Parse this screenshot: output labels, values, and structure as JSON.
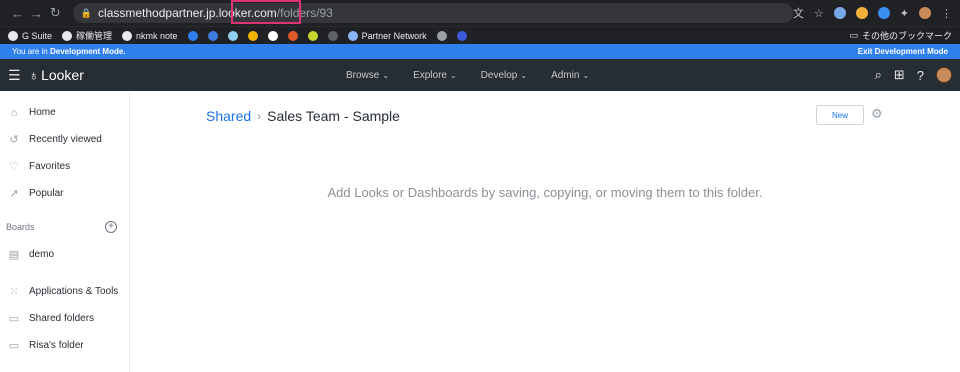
{
  "browser": {
    "url_host": "classmethodpartner.jp.looker.com",
    "url_path": "/folders/93"
  },
  "bookmarks": {
    "items": [
      "G Suite",
      "稼働管理",
      "nkmk note",
      "Partner Network"
    ],
    "other": "その他のブックマーク"
  },
  "dev_bar": {
    "prefix": "You are in ",
    "mode": "Development Mode.",
    "exit": "Exit Development Mode"
  },
  "header": {
    "logo": "Looker",
    "nav": [
      "Browse",
      "Explore",
      "Develop",
      "Admin"
    ]
  },
  "sidebar": {
    "items": [
      {
        "label": "Home",
        "icon": "home-icon"
      },
      {
        "label": "Recently viewed",
        "icon": "history-icon"
      },
      {
        "label": "Favorites",
        "icon": "heart-icon"
      },
      {
        "label": "Popular",
        "icon": "trending-icon"
      }
    ],
    "boards_heading": "Boards",
    "boards": [
      {
        "label": "demo",
        "icon": "board-icon"
      }
    ],
    "bottom": [
      {
        "label": "Applications & Tools",
        "icon": "apps-icon"
      },
      {
        "label": "Shared folders",
        "icon": "folder-icon"
      },
      {
        "label": "Risa's folder",
        "icon": "folder-icon"
      }
    ]
  },
  "content": {
    "breadcrumb_root": "Shared",
    "breadcrumb_current": "Sales Team - Sample",
    "new_button": "New",
    "empty_message": "Add Looks or Dashboards by saving, copying, or moving them to this folder."
  },
  "colors": {
    "accent": "#1a73e8",
    "dev_bar": "#2f80ed",
    "header": "#262d33",
    "highlight": "#e0336e"
  }
}
